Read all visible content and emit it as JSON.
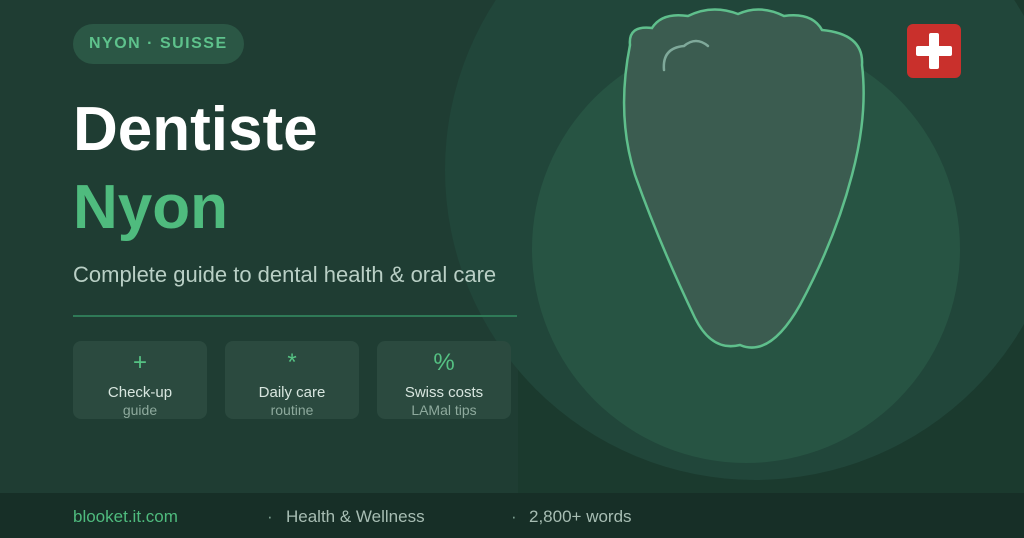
{
  "badge": {
    "text": "NYON · SUISSE"
  },
  "hero": {
    "title_line1": "Dentiste",
    "title_line2": "Nyon",
    "subtitle": "Complete guide to dental health & oral care"
  },
  "cards": [
    {
      "icon": "+",
      "icon_name": "plus-icon",
      "title": "Check-up",
      "subtitle": "guide"
    },
    {
      "icon": "*",
      "icon_name": "asterisk-icon",
      "title": "Daily care",
      "subtitle": "routine"
    },
    {
      "icon": "%",
      "icon_name": "percent-icon",
      "title": "Swiss costs",
      "subtitle": "LAMal tips"
    }
  ],
  "footer": {
    "site": "blooket.it.com",
    "separator": "·",
    "category": "Health & Wellness",
    "word_count": "2,800+ words"
  },
  "colors": {
    "accent": "#4fbb7e",
    "background": "#1f3d33",
    "flag_red": "#c9302c"
  }
}
